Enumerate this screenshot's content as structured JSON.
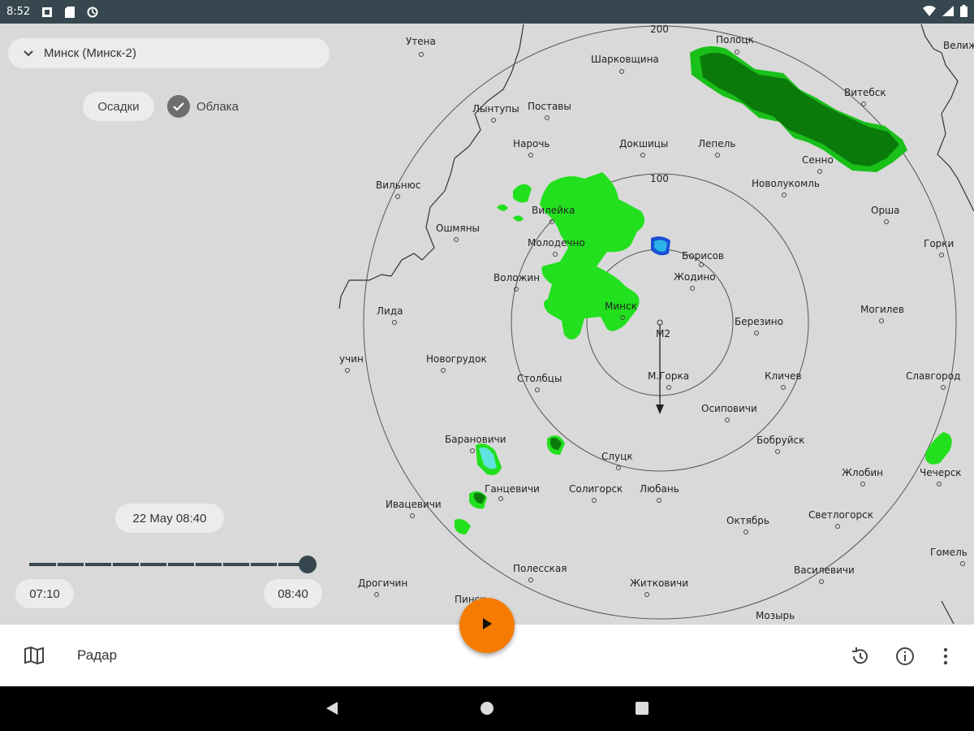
{
  "status_bar": {
    "time": "8:52"
  },
  "station": {
    "selected": "Минск (Минск-2)"
  },
  "layers": {
    "precipitation": "Осадки",
    "clouds": "Облака"
  },
  "timeline": {
    "current": "22 May 08:40",
    "start": "07:10",
    "end": "08:40",
    "position_fraction": 1.0
  },
  "map": {
    "ring_labels": [
      "100",
      "200"
    ],
    "station_label": "М2",
    "cities": [
      "Утена",
      "Шарковщина",
      "Полоцк",
      "Витебск",
      "Поставы",
      "Лынтупы",
      "Нарочь",
      "Докшицы",
      "Лепель",
      "Сенно",
      "Вильнюс",
      "Новолукомль",
      "Орша",
      "Вилейка",
      "Ошмяны",
      "Молодечно",
      "Борисов",
      "Горки",
      "Воложин",
      "Жодино",
      "Лида",
      "Минск",
      "Березино",
      "Могилев",
      "Новогрудок",
      "Столбцы",
      "М.Горка",
      "Кличев",
      "Славгород",
      "Осиповичи",
      "Барановичи",
      "Бобруйск",
      "Слуцк",
      "Жлобин",
      "Чечерск",
      "Ганцевичи",
      "Солигорск",
      "Любань",
      "Ивацевичи",
      "Октябрь",
      "Светлогорск",
      "Гомель",
      "Полесская",
      "Дрогичин",
      "Василевичи",
      "Житковичи",
      "Мозырь",
      "Пинск",
      "Велиж",
      "учин"
    ]
  },
  "bottom_bar": {
    "title": "Радар"
  },
  "colors": {
    "accent": "#f57c00",
    "bar": "#37474f",
    "rain_light": "#22e01e",
    "rain_heavy": "#0a7a0a"
  }
}
